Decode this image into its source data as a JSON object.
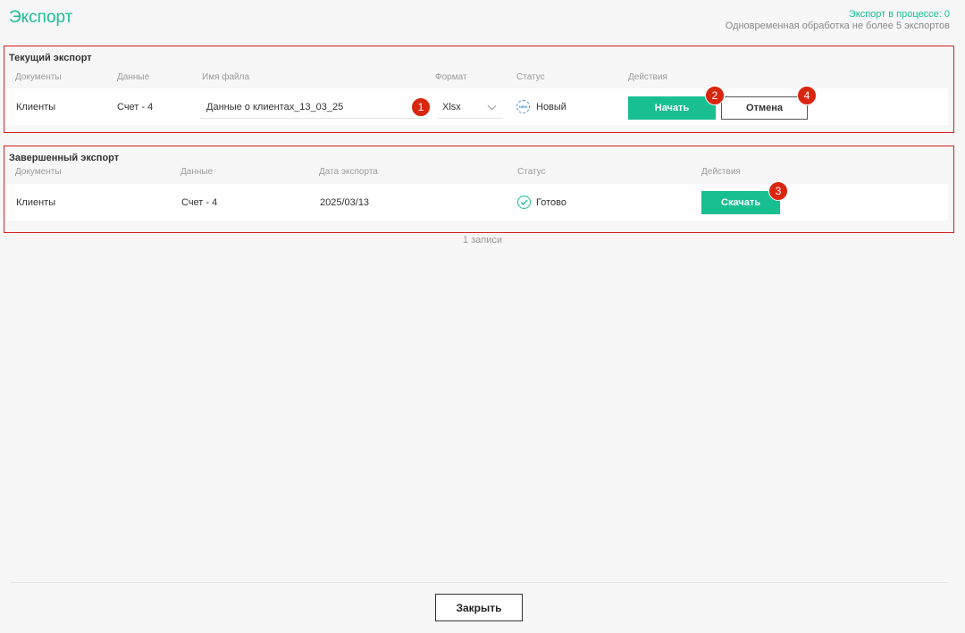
{
  "header": {
    "title": "Экспорт",
    "in_process": "Экспорт в процессе: 0",
    "limit_note": "Одновременная обработка не более 5 экспортов"
  },
  "current_export": {
    "title": "Текущий экспорт",
    "columns": {
      "documents": "Документы",
      "data": "Данные",
      "filename": "Имя файла",
      "format": "Формат",
      "status": "Статус",
      "actions": "Действия"
    },
    "row": {
      "documents": "Клиенты",
      "data": "Счет - 4",
      "filename": "Данные о клиентах_13_03_25",
      "format": "Xlsx",
      "status": "Новый",
      "status_icon_text": "NEW",
      "start_label": "Начать",
      "cancel_label": "Отмена"
    }
  },
  "completed_export": {
    "title": "Завершенный экспорт",
    "columns": {
      "documents": "Документы",
      "data": "Данные",
      "export_date": "Дата экспорта",
      "status": "Статус",
      "actions": "Действия"
    },
    "row": {
      "documents": "Клиенты",
      "data": "Счет - 4",
      "export_date": "2025/03/13",
      "status": "Готово",
      "download_label": "Скачать"
    },
    "records": "1 записи"
  },
  "markers": [
    "1",
    "2",
    "3",
    "4"
  ],
  "footer": {
    "close_label": "Закрыть"
  },
  "colors": {
    "accent": "#17bf91",
    "marker": "#d9260f",
    "highlight_border": "#d62020",
    "new_status": "#3d8be0"
  },
  "icons": {
    "new_status": "new-status-icon",
    "done_status": "check-circle-icon",
    "format_dropdown": "chevron-down-icon"
  }
}
